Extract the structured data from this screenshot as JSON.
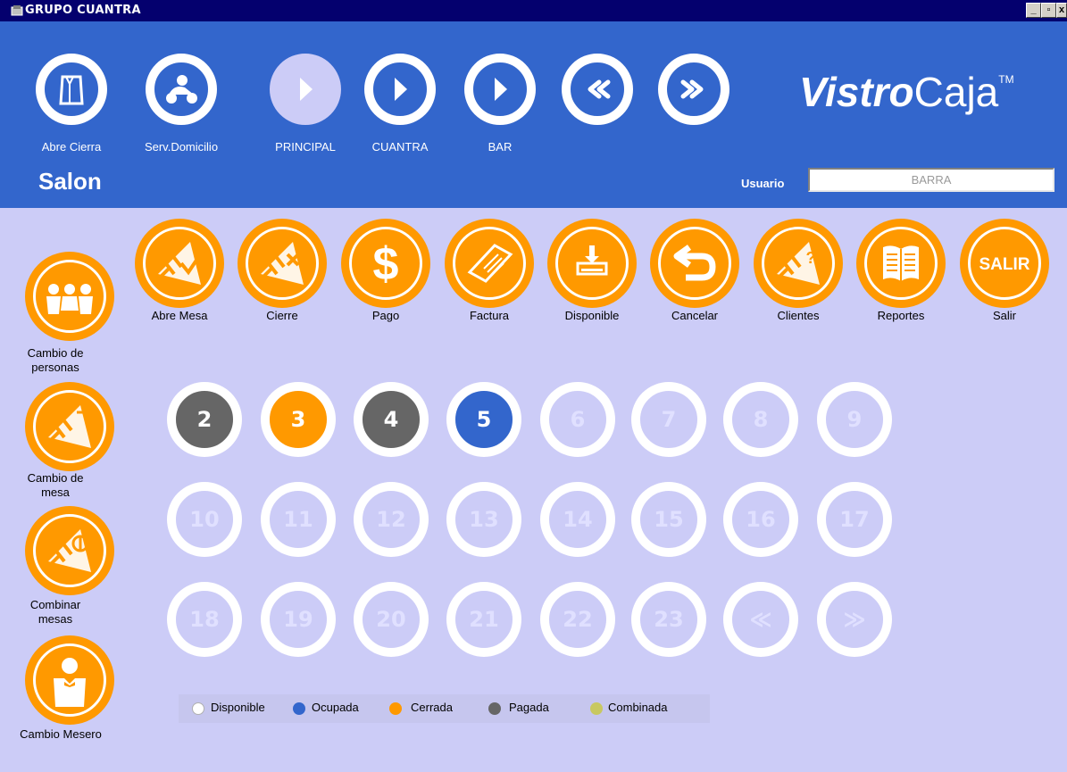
{
  "window": {
    "title": "GRUPO CUANTRA",
    "minimize": "_",
    "restore": "▫",
    "close": "x"
  },
  "header": {
    "nav": [
      {
        "label": "Abre Cierra",
        "icon": "paper-bag-icon"
      },
      {
        "label": "Serv.Domicilio",
        "icon": "delivery-scooter-icon"
      },
      {
        "label": "PRINCIPAL",
        "icon": "play-icon",
        "active": true
      },
      {
        "label": "CUANTRA",
        "icon": "play-icon"
      },
      {
        "label": "BAR",
        "icon": "play-icon"
      },
      {
        "label": "",
        "icon": "previous-icon"
      },
      {
        "label": "",
        "icon": "next-icon"
      }
    ],
    "logo_bold": "Vistro",
    "logo_light": "Caja",
    "logo_tm": "TM",
    "section_title": "Salon",
    "user_label": "Usuario",
    "user_value": "BARRA"
  },
  "actions": [
    {
      "label": "Abre Mesa",
      "icon": "open-table-icon"
    },
    {
      "label": "Cierre",
      "icon": "close-table-icon"
    },
    {
      "label": "Pago",
      "icon": "dollar-icon"
    },
    {
      "label": "Factura",
      "icon": "invoice-icon"
    },
    {
      "label": "Disponible",
      "icon": "available-icon"
    },
    {
      "label": "Cancelar",
      "icon": "undo-icon"
    },
    {
      "label": "Clientes",
      "icon": "clients-icon"
    },
    {
      "label": "Reportes",
      "icon": "reports-icon"
    },
    {
      "label": "Salir",
      "icon": "exit-icon",
      "text": "SALIR"
    }
  ],
  "side": [
    {
      "label": "Cambio de personas",
      "icon": "people-icon"
    },
    {
      "label": "Cambio de mesa",
      "icon": "change-table-icon"
    },
    {
      "label": "Combinar mesas",
      "icon": "combine-tables-icon"
    },
    {
      "label": "Cambio Mesero",
      "icon": "waiter-icon"
    }
  ],
  "tables": [
    {
      "label": "2",
      "status": "Pagada"
    },
    {
      "label": "3",
      "status": "Cerrada"
    },
    {
      "label": "4",
      "status": "Pagada"
    },
    {
      "label": "5",
      "status": "Ocupada"
    },
    {
      "label": "6",
      "status": "Disponible"
    },
    {
      "label": "7",
      "status": "Disponible"
    },
    {
      "label": "8",
      "status": "Disponible"
    },
    {
      "label": "9",
      "status": "Disponible"
    },
    {
      "label": "10",
      "status": "Disponible"
    },
    {
      "label": "11",
      "status": "Disponible"
    },
    {
      "label": "12",
      "status": "Disponible"
    },
    {
      "label": "13",
      "status": "Disponible"
    },
    {
      "label": "14",
      "status": "Disponible"
    },
    {
      "label": "15",
      "status": "Disponible"
    },
    {
      "label": "16",
      "status": "Disponible"
    },
    {
      "label": "17",
      "status": "Disponible"
    },
    {
      "label": "18",
      "status": "Disponible"
    },
    {
      "label": "19",
      "status": "Disponible"
    },
    {
      "label": "20",
      "status": "Disponible"
    },
    {
      "label": "21",
      "status": "Disponible"
    },
    {
      "label": "22",
      "status": "Disponible"
    },
    {
      "label": "23",
      "status": "Disponible"
    }
  ],
  "pager": {
    "prev": "≪",
    "next": "≫"
  },
  "legend": [
    {
      "label": "Disponible",
      "color": "#ffffff"
    },
    {
      "label": "Ocupada",
      "color": "#3366cc"
    },
    {
      "label": "Cerrada",
      "color": "#ff9900"
    },
    {
      "label": "Pagada",
      "color": "#666666"
    },
    {
      "label": "Combinada",
      "color": "#c8c860"
    }
  ],
  "colors": {
    "header_bg": "#3366cc",
    "body_bg": "#ccccf7",
    "accent": "#ff9900",
    "titlebar": "#04006e"
  }
}
